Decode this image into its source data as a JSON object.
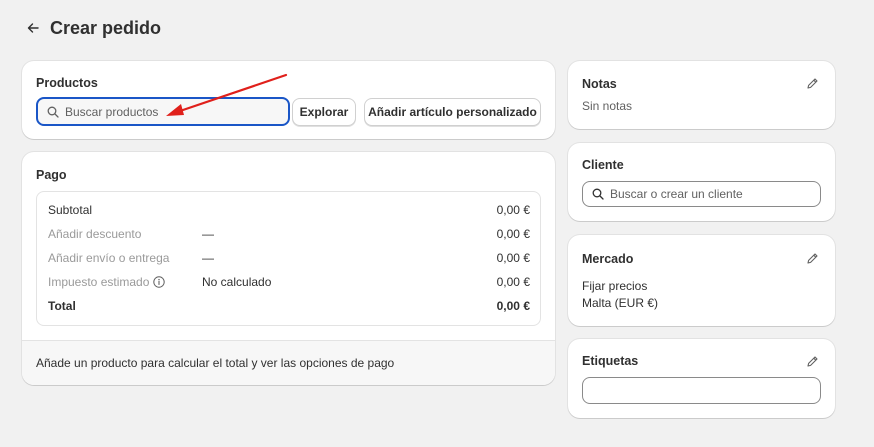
{
  "header": {
    "title": "Crear pedido",
    "back_icon": "arrow-left-icon"
  },
  "products": {
    "title": "Productos",
    "search_placeholder": "Buscar productos",
    "explore_label": "Explorar",
    "custom_item_label": "Añadir artículo personalizado"
  },
  "payment": {
    "title": "Pago",
    "rows": [
      {
        "label": "Subtotal",
        "middle": "",
        "amount": "0,00 €"
      },
      {
        "label": "Añadir descuento",
        "middle": "—",
        "amount": "0,00 €"
      },
      {
        "label": "Añadir envío o entrega",
        "middle": "—",
        "amount": "0,00 €"
      },
      {
        "label": "Impuesto estimado",
        "middle": "No calculado",
        "amount": "0,00 €"
      },
      {
        "label": "Total",
        "middle": "",
        "amount": "0,00 €"
      }
    ],
    "footer": "Añade un producto para calcular el total y ver las opciones de pago"
  },
  "notes": {
    "title": "Notas",
    "text": "Sin notas"
  },
  "client": {
    "title": "Cliente",
    "search_placeholder": "Buscar o crear un cliente"
  },
  "market": {
    "title": "Mercado",
    "line1": "Fijar precios",
    "line2": "Malta (EUR €)"
  },
  "tags": {
    "title": "Etiquetas",
    "value": ""
  },
  "colors": {
    "background": "#f1f1f1",
    "focus_border": "#1a56c7",
    "annotation_arrow": "#e0201b"
  }
}
